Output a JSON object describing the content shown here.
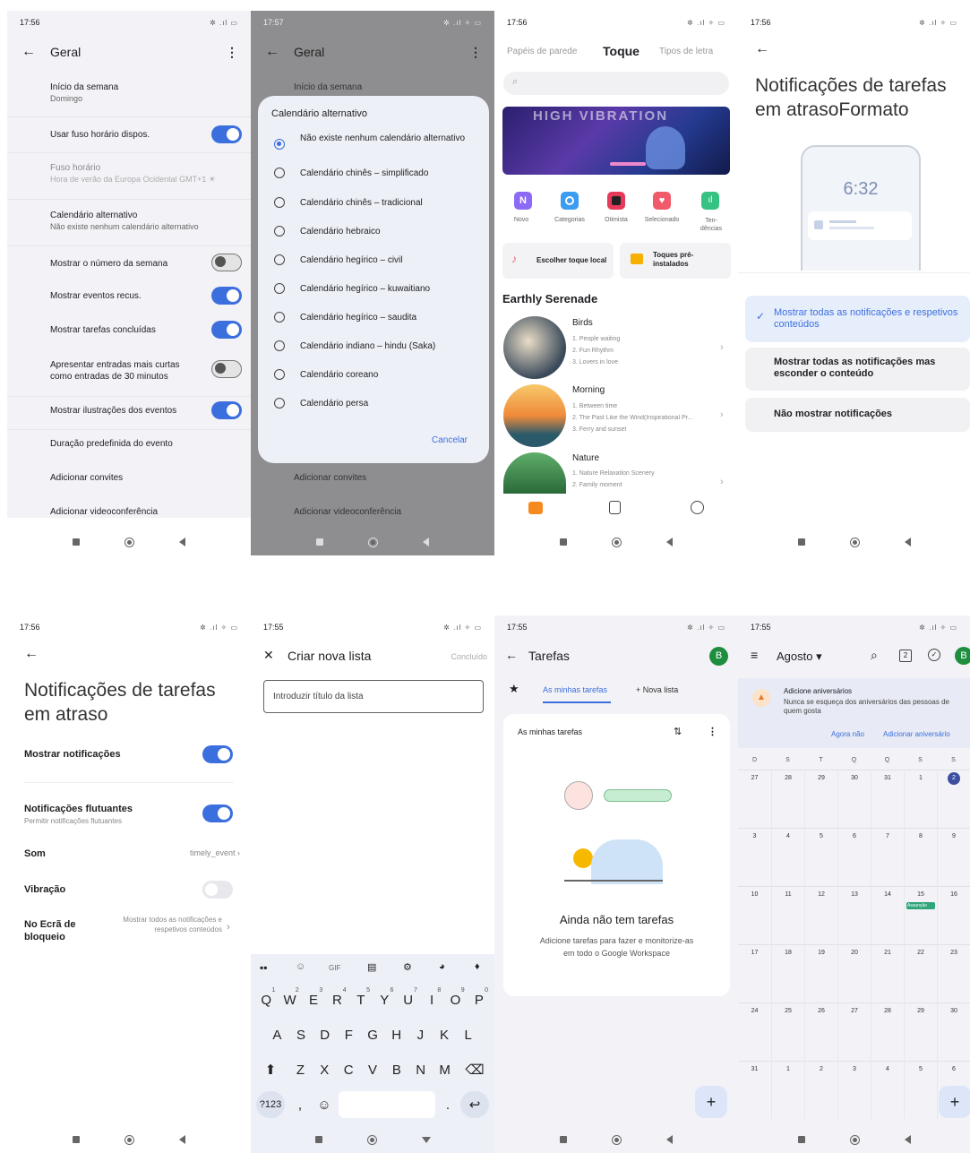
{
  "p1": {
    "time": "17:56",
    "title": "Geral",
    "rows": [
      {
        "label": "Início da semana",
        "sub": "Domingo"
      },
      {
        "label": "Usar fuso horário dispos."
      },
      {
        "label": "Fuso horário",
        "sub": "Hora de verão da Europa Ocidental GMT+1 ☀"
      },
      {
        "label": "Calendário alternativo",
        "sub": "Não existe nenhum calendário alternativo"
      },
      {
        "label": "Mostrar o número da semana"
      },
      {
        "label": "Mostrar eventos recus."
      },
      {
        "label": "Mostrar tarefas concluídas"
      },
      {
        "label": "Apresentar entradas mais curtas como entradas de 30 minutos"
      },
      {
        "label": "Mostrar ilustrações dos eventos"
      },
      {
        "label": "Duração predefinida do evento"
      },
      {
        "label": "Adicionar convites"
      },
      {
        "label": "Adicionar videoconferência"
      }
    ]
  },
  "p2": {
    "time": "17:57",
    "title": "Geral",
    "bg_top": "Início da semana",
    "bg_b1": "Adicionar convites",
    "bg_b2": "Adicionar videoconferência",
    "dialog_title": "Calendário alternativo",
    "options": [
      "Não existe nenhum calendário alternativo",
      "Calendário chinês – simplificado",
      "Calendário chinês – tradicional",
      "Calendário hebraico",
      "Calendário hegírico – civil",
      "Calendário hegírico – kuwaitiano",
      "Calendário hegírico – saudita",
      "Calendário indiano – hindu (Saka)",
      "Calendário coreano",
      "Calendário persa"
    ],
    "cancel": "Cancelar"
  },
  "p3": {
    "time": "17:56",
    "tabs": [
      "Papéis de parede",
      "Toque",
      "Tipos de letra"
    ],
    "banner": "HIGH VIBRATION",
    "cats": [
      "Novo",
      "Categorias",
      "Otimista",
      "Selecionado",
      "Ten-dências"
    ],
    "btn1": "Escolher toque local",
    "btn2": "Toques pré-instalados",
    "section": "Earthly Serenade",
    "items": [
      {
        "title": "Birds",
        "lines": [
          "1. People waiting",
          "2. Fun Rhythm",
          "3. Lovers in love"
        ]
      },
      {
        "title": "Morning",
        "lines": [
          "1. Between time",
          "2. The Past Like the Wind(Inspirational Pr...",
          "3. Ferry and sunset"
        ]
      },
      {
        "title": "Nature",
        "lines": [
          "1. Nature Relaxation Scenery",
          "2. Family moment"
        ]
      }
    ]
  },
  "p4": {
    "time": "17:56",
    "heading": "Notificações de tarefas em atrasoFormato",
    "clock": "6:32",
    "opt1": "Mostrar todas as notificações e respetivos conteúdos",
    "opt2": "Mostrar todas as notificações mas esconder o conteúdo",
    "opt3": "Não mostrar notificações"
  },
  "p5": {
    "time": "17:56",
    "heading": "Notificações de tarefas em atraso",
    "show": "Mostrar notificações",
    "float": "Notificações flutuantes",
    "float_sub": "Permitir notificações flutuantes",
    "sound": "Som",
    "sound_val": "timely_event",
    "vib": "Vibração",
    "lock": "No Ecrã de bloqueio",
    "lock_val": "Mostrar todos as notificações e respetivos conteúdos"
  },
  "p6": {
    "time": "17:55",
    "title": "Criar nova lista",
    "done": "Concluído",
    "placeholder": "Introduzir título da lista",
    "gif": "GIF",
    "row1": [
      "Q",
      "W",
      "E",
      "R",
      "T",
      "Y",
      "U",
      "I",
      "O",
      "P"
    ],
    "nums": [
      "1",
      "2",
      "3",
      "4",
      "5",
      "6",
      "7",
      "8",
      "9",
      "0"
    ],
    "row2": [
      "A",
      "S",
      "D",
      "F",
      "G",
      "H",
      "J",
      "K",
      "L"
    ],
    "row3": [
      "Z",
      "X",
      "C",
      "V",
      "B",
      "N",
      "M"
    ],
    "k123": "?123",
    "comma": ",",
    "dot": "."
  },
  "p7": {
    "time": "17:55",
    "title": "Tarefas",
    "avatar": "B",
    "tab1": "As minhas tarefas",
    "tab2": "+ Nova lista",
    "card_title": "As minhas tarefas",
    "empty": "Ainda não tem tarefas",
    "empty_sub": "Adicione tarefas para fazer e monitorize-as em todo o Google Workspace"
  },
  "p8": {
    "time": "17:55",
    "month": "Agosto ▾",
    "avatar": "B",
    "cal_icon": "2",
    "card_title": "Adicione aniversários",
    "card_sub": "Nunca se esqueça dos aniversários das pessoas de quem gosta",
    "no": "Agora não",
    "add": "Adicionar aniversário",
    "days": [
      "D",
      "S",
      "T",
      "Q",
      "Q",
      "S",
      "S"
    ],
    "weeks": [
      [
        "27",
        "28",
        "29",
        "30",
        "31",
        "1",
        "2"
      ],
      [
        "3",
        "4",
        "5",
        "6",
        "7",
        "8",
        "9"
      ],
      [
        "10",
        "11",
        "12",
        "13",
        "14",
        "15",
        "16"
      ],
      [
        "17",
        "18",
        "19",
        "20",
        "21",
        "22",
        "23"
      ],
      [
        "24",
        "25",
        "26",
        "27",
        "28",
        "29",
        "30"
      ],
      [
        "31",
        "1",
        "2",
        "3",
        "4",
        "5",
        "6"
      ]
    ],
    "event": "Assunção"
  }
}
